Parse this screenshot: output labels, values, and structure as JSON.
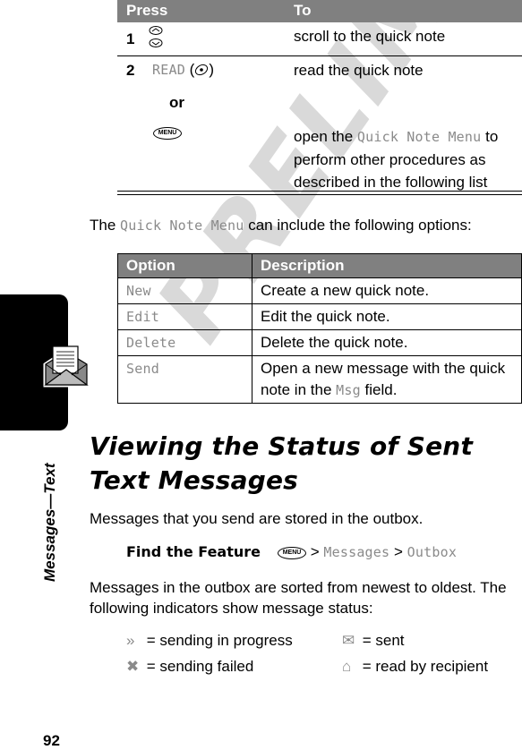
{
  "watermark": "PRELIMINARY",
  "side_tab": {
    "label": "Messages—Text",
    "icon": "envelope-letter-icon"
  },
  "press_table": {
    "headers": [
      "Press",
      "To"
    ],
    "rows": [
      {
        "step": "1",
        "press_icon": "scroll-up-down-icon",
        "to": "scroll to the quick note"
      },
      {
        "step": "2",
        "press_label": "READ",
        "press_icon": "select-key-icon",
        "to": "read the quick note"
      },
      {
        "or": "or",
        "press_icon": "menu-key-icon",
        "to_prefix": "open the ",
        "to_highlight": "Quick Note Menu",
        "to_suffix": " to perform other procedures as described in the following list"
      }
    ],
    "menu_key_label": "MENU"
  },
  "intro": {
    "prefix": "The ",
    "highlight": "Quick Note Menu",
    "suffix": " can include the following options:"
  },
  "options_table": {
    "headers": [
      "Option",
      "Description"
    ],
    "rows": [
      {
        "option": "New",
        "description": "Create a new quick note."
      },
      {
        "option": "Edit",
        "description": "Edit the quick note."
      },
      {
        "option": "Delete",
        "description": "Delete the quick note."
      },
      {
        "option": "Send",
        "description_prefix": "Open a new message with the quick note in the ",
        "description_highlight": "Msg",
        "description_suffix": " field."
      }
    ]
  },
  "section": {
    "title": "Viewing the Status of Sent Text Messages",
    "para1": "Messages that you send are stored in the outbox.",
    "find_feature": {
      "label": "Find the Feature",
      "key": "MENU",
      "sep": ">",
      "path": [
        "Messages",
        "Outbox"
      ]
    },
    "para2": "Messages in the outbox are sorted from newest to oldest. The following indicators show message status:",
    "indicators": [
      {
        "icon": "sending-in-progress-icon",
        "glyph": "»",
        "text": "= sending in progress"
      },
      {
        "icon": "sent-envelope-icon",
        "glyph": "✉",
        "text": "= sent"
      },
      {
        "icon": "sending-failed-icon",
        "glyph": "✖",
        "text": "= sending failed"
      },
      {
        "icon": "read-by-recipient-icon",
        "glyph": "⌂",
        "text": "= read by recipient"
      }
    ]
  },
  "page_number": "92"
}
